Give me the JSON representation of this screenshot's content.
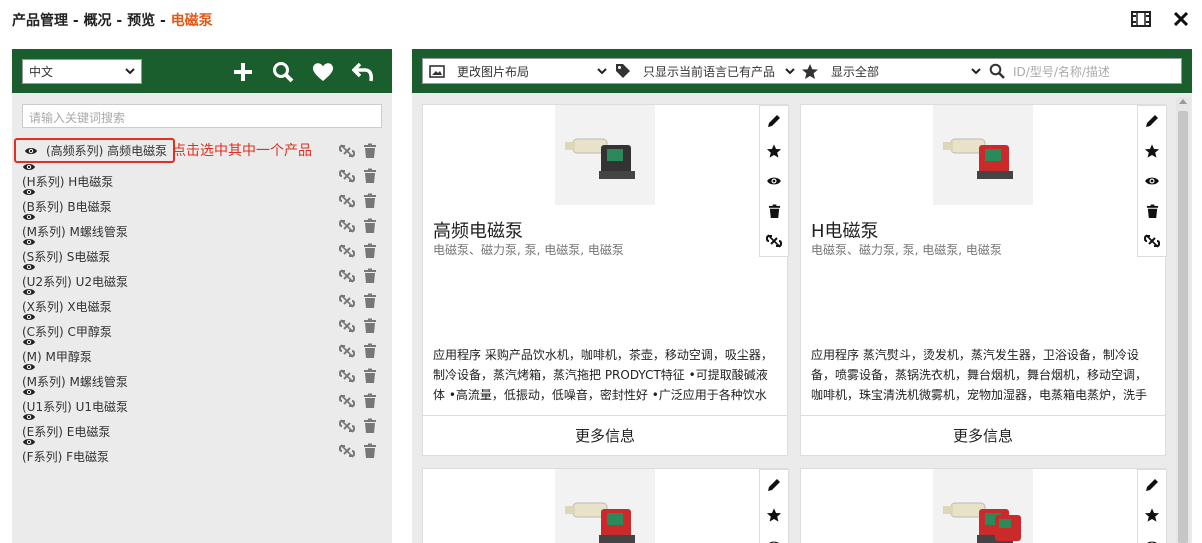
{
  "titlebar": {
    "crumb_1": "产品管理",
    "sep": " - ",
    "crumb_2": "概况",
    "crumb_3": "预览",
    "current": "电磁泵",
    "layout_icon": "film-icon",
    "close_icon": "close-icon"
  },
  "left": {
    "language_select": "中文",
    "toolbar_icons": [
      "plus-icon",
      "search-icon",
      "heart-icon",
      "undo-icon"
    ],
    "search_placeholder": "请输入关键词搜索",
    "annotation": "点击选中其中一个产品",
    "items": [
      {
        "label": "(高频系列) 高频电磁泵"
      },
      {
        "label": "(H系列) H电磁泵"
      },
      {
        "label": "(B系列) B电磁泵"
      },
      {
        "label": "(M系列) M螺线管泵"
      },
      {
        "label": "(S系列) S电磁泵"
      },
      {
        "label": "(U2系列) U2电磁泵"
      },
      {
        "label": "(X系列) X电磁泵"
      },
      {
        "label": "(C系列) C甲醇泵"
      },
      {
        "label": "(M) M甲醇泵"
      },
      {
        "label": "(M系列) M螺线管泵"
      },
      {
        "label": "(U1系列) U1电磁泵"
      },
      {
        "label": "(E系列) E电磁泵"
      },
      {
        "label": "(F系列) F电磁泵"
      }
    ]
  },
  "right": {
    "layout_select": "更改图片布局",
    "lang_filter": "只显示当前语言已有产品",
    "fav_filter": "显示全部",
    "search_placeholder": "ID/型号/名称/描述",
    "cards": [
      {
        "title": "高频电磁泵",
        "tags": "电磁泵、磁力泵, 泵, 电磁泵, 电磁泵",
        "desc": "应用程序 采购产品饮水机，咖啡机，茶壶，移动空调，吸尘器，制冷设备，蒸汽烤箱，蒸汽拖把 PRODYCT特征 •可提取酸碱液体 •高流量，低振动，低噪音，密封性好 •广泛应用于各种饮水机",
        "more": "更多信息"
      },
      {
        "title": "H电磁泵",
        "tags": "电磁泵、磁力泵, 泵, 电磁泵, 电磁泵",
        "desc": "应用程序 蒸汽熨斗，烫发机，蒸汽发生器，卫浴设备，制冷设备，喷雾设备，蒸锅洗衣机，舞台烟机，舞台烟机，移动空调，咖啡机，珠宝清洗机微雾机，宠物加湿器，电蒸箱电蒸炉，洗手",
        "more": "更多信息"
      }
    ]
  },
  "colors": {
    "header_green": "#1a5e2d",
    "accent_orange": "#e05a17",
    "annotation_red": "#e03020"
  }
}
